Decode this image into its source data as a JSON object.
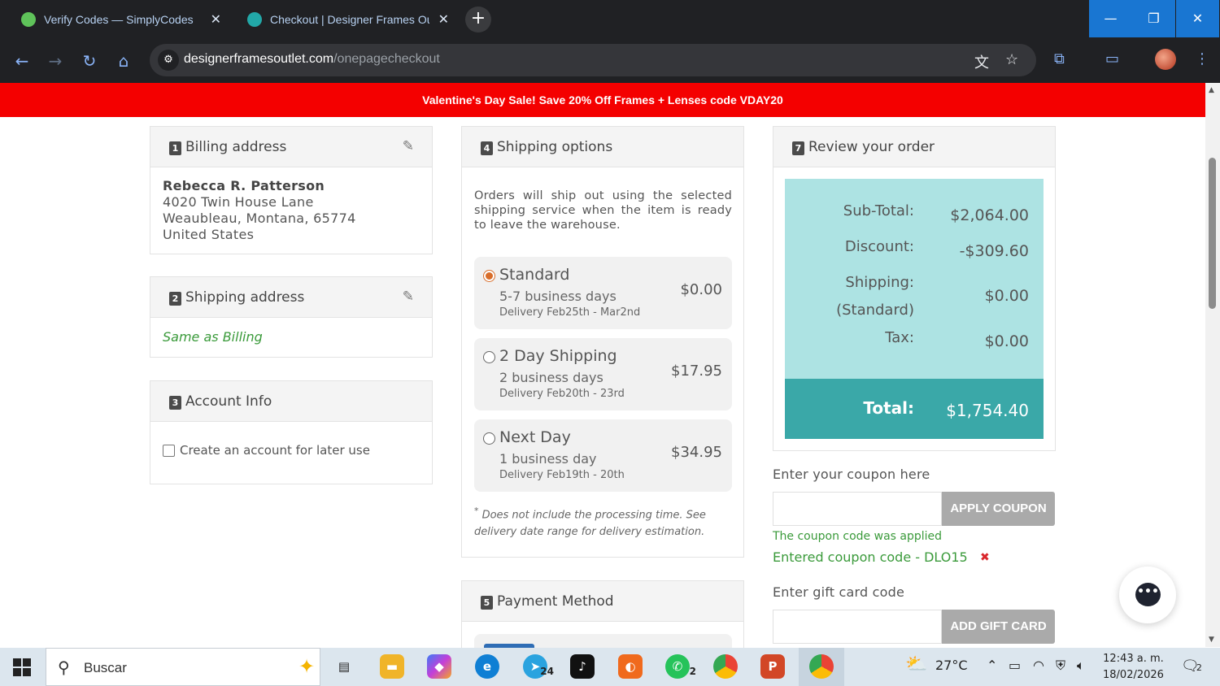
{
  "browser": {
    "tabs": [
      {
        "title": "Verify Codes — SimplyCodes",
        "favicon_color": "#5fc35a"
      },
      {
        "title": "Checkout | Designer Frames Outlet",
        "favicon_color": "#22a8a8"
      }
    ],
    "url_domain": "designerframesoutlet.com",
    "url_path": "/onepagecheckout"
  },
  "promo_text": "Valentine's Day Sale! Save 20% Off Frames + Lenses code VDAY20",
  "billing": {
    "step": "1",
    "title": "Billing address",
    "name": "Rebecca R. Patterson",
    "street": "4020 Twin House Lane",
    "city_line": "Weaubleau, Montana, 65774",
    "country": "United States"
  },
  "shipping_address": {
    "step": "2",
    "title": "Shipping address",
    "value": "Same as Billing"
  },
  "account": {
    "step": "3",
    "title": "Account Info",
    "checkbox_label": "Create an account for later use"
  },
  "shipping_options": {
    "step": "4",
    "title": "Shipping options",
    "intro": "Orders will ship out using the selected shipping service when the item is ready to leave the warehouse.",
    "options": [
      {
        "name": "Standard",
        "days": "5-7 business days",
        "delivery": "Delivery Feb25th - Mar2nd",
        "price": "$0.00",
        "selected": true
      },
      {
        "name": "2 Day Shipping",
        "days": "2 business days",
        "delivery": "Delivery Feb20th - 23rd",
        "price": "$17.95",
        "selected": false
      },
      {
        "name": "Next Day",
        "days": "1 business day",
        "delivery": "Delivery Feb19th - 20th",
        "price": "$34.95",
        "selected": false
      }
    ],
    "note_mark": "*",
    "note": "Does not include the processing time. See delivery date range for delivery estimation."
  },
  "payment": {
    "step": "5",
    "title": "Payment Method"
  },
  "review": {
    "step": "7",
    "title": "Review your order",
    "subtotal_label": "Sub-Total:",
    "subtotal": "$2,064.00",
    "discount_label": "Discount:",
    "discount": "-$309.60",
    "shipping_label": "Shipping:",
    "shipping_method": "(Standard)",
    "shipping": "$0.00",
    "tax_label": "Tax:",
    "tax": "$0.00",
    "total_label": "Total:",
    "total": "$1,754.40",
    "colors": {
      "summary_bg": "#ade3e3",
      "total_bg": "#3aa8a8"
    }
  },
  "coupon": {
    "label": "Enter your coupon here",
    "button": "APPLY COUPON",
    "applied_msg": "The coupon code was applied",
    "entered_msg": "Entered coupon code - DLO15"
  },
  "giftcard": {
    "label": "Enter gift card code",
    "button": "ADD GIFT CARD"
  },
  "taskbar": {
    "search_placeholder": "Buscar",
    "weather": "27°C",
    "time": "12:43 a. m.",
    "date": "18/02/2026",
    "telegram_badge": "24",
    "whatsapp_badge": "2",
    "notification_badge": "2"
  },
  "theme": {
    "accent_green": "#3a9a3a",
    "promo_red": "#f40000",
    "radio_selected": "#d86d2a"
  }
}
